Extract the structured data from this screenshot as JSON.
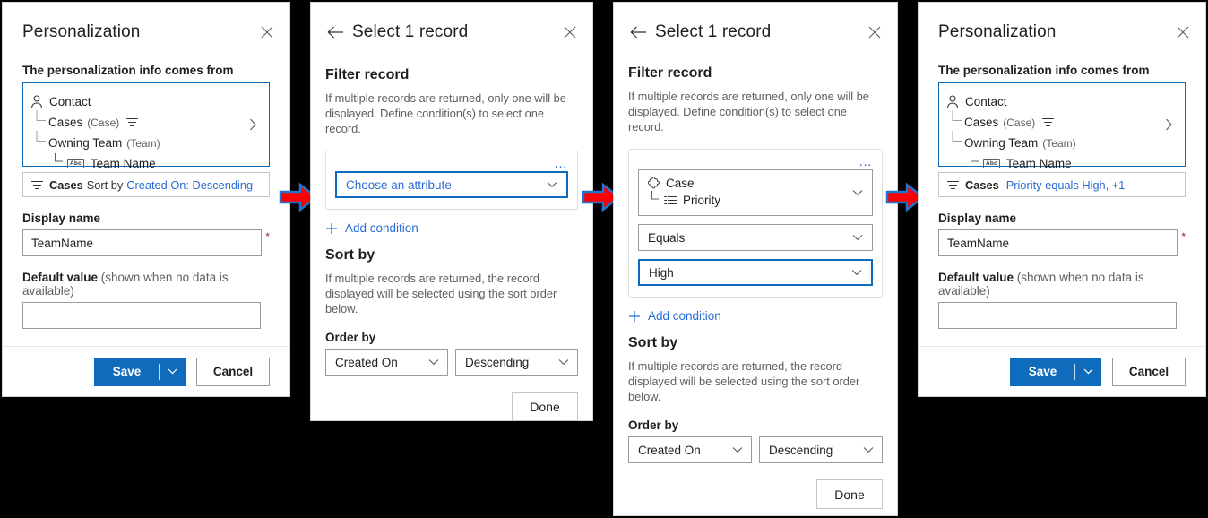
{
  "panels": {
    "personalization_left": {
      "title": "Personalization",
      "close_label": "✕",
      "source_label": "The personalization info comes from",
      "tree": [
        {
          "label": "Contact",
          "sub": "",
          "icon": "contact-icon",
          "indent": 0,
          "filtered": false
        },
        {
          "label": "Cases",
          "sub": "(Case)",
          "icon": "elbow",
          "indent": 1,
          "filtered": true
        },
        {
          "label": "Owning Team",
          "sub": "(Team)",
          "icon": "elbow",
          "indent": 1,
          "filtered": false
        },
        {
          "label": "Team Name",
          "sub": "",
          "icon": "abc-icon",
          "indent": 2,
          "filtered": false
        }
      ],
      "abc_badge": "Abc",
      "pill": {
        "entity": "Cases",
        "middle": "Sort by",
        "link": "Created On: Descending"
      },
      "display_name_label": "Display name",
      "display_name_value": "TeamName",
      "required_mark": "*",
      "default_value_label": "Default value",
      "default_value_hint": "(shown when no data is available)",
      "default_value_value": "",
      "save_label": "Save",
      "cancel_label": "Cancel"
    },
    "select_record_empty": {
      "title": "Select 1 record",
      "back_label": "←",
      "close_label": "✕",
      "filter_heading": "Filter record",
      "filter_helper": "If multiple records are returned, only one will be displayed. Define condition(s) to select one record.",
      "overflow_label": "…",
      "attribute_placeholder": "Choose an attribute",
      "add_condition_label": "Add condition",
      "sort_heading": "Sort by",
      "sort_helper": "If multiple records are returned, the record displayed will be selected using the sort order below.",
      "order_by_label": "Order by",
      "order_field": "Created On",
      "order_direction": "Descending",
      "done_label": "Done"
    },
    "select_record_filled": {
      "title": "Select 1 record",
      "back_label": "←",
      "close_label": "✕",
      "filter_heading": "Filter record",
      "filter_helper": "If multiple records are returned, only one will be displayed. Define condition(s) to select one record.",
      "overflow_label": "…",
      "attribute_entity": "Case",
      "attribute_field": "Priority",
      "operator_value": "Equals",
      "value_value": "High",
      "add_condition_label": "Add condition",
      "sort_heading": "Sort by",
      "sort_helper": "If multiple records are returned, the record displayed will be selected using the sort order below.",
      "order_by_label": "Order by",
      "order_field": "Created On",
      "order_direction": "Descending",
      "done_label": "Done"
    },
    "personalization_right": {
      "title": "Personalization",
      "close_label": "✕",
      "source_label": "The personalization info comes from",
      "tree": [
        {
          "label": "Contact",
          "sub": "",
          "icon": "contact-icon",
          "indent": 0,
          "filtered": false
        },
        {
          "label": "Cases",
          "sub": "(Case)",
          "icon": "elbow",
          "indent": 1,
          "filtered": true
        },
        {
          "label": "Owning Team",
          "sub": "(Team)",
          "icon": "elbow",
          "indent": 1,
          "filtered": false
        },
        {
          "label": "Team Name",
          "sub": "",
          "icon": "abc-icon",
          "indent": 2,
          "filtered": false
        }
      ],
      "abc_badge": "Abc",
      "pill": {
        "entity": "Cases",
        "middle": "",
        "link": "Priority equals High, +1"
      },
      "display_name_label": "Display name",
      "display_name_value": "TeamName",
      "required_mark": "*",
      "default_value_label": "Default value",
      "default_value_hint": "(shown when no data is available)",
      "default_value_value": "",
      "save_label": "Save",
      "cancel_label": "Cancel"
    }
  },
  "arrows": [
    {
      "name": "flow-arrow-1"
    },
    {
      "name": "flow-arrow-2"
    },
    {
      "name": "flow-arrow-3"
    }
  ],
  "colors": {
    "accent": "#0f6cbd",
    "link": "#2b6cd4",
    "arrow_fill": "#ff0000",
    "arrow_stroke": "#1f74d0",
    "required": "#a4262c",
    "background": "#000000"
  }
}
